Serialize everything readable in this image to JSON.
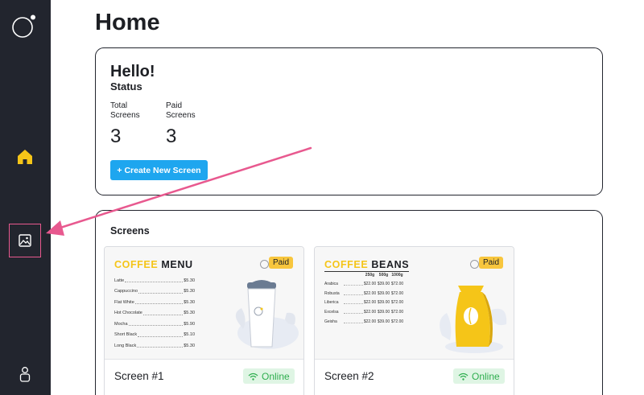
{
  "sidebar": {
    "items": [
      {
        "name": "home",
        "icon": "home-icon",
        "color": "#f5c518"
      },
      {
        "name": "screens",
        "icon": "image-icon",
        "highlight": "#e8598f"
      },
      {
        "name": "account",
        "icon": "user-icon"
      }
    ]
  },
  "page": {
    "title": "Home"
  },
  "status_card": {
    "greeting": "Hello!",
    "title": "Status",
    "stats": [
      {
        "label_line1": "Total",
        "label_line2": "Screens",
        "value": "3"
      },
      {
        "label_line1": "Paid",
        "label_line2": "Screens",
        "value": "3"
      }
    ],
    "create_button": "+ Create New Screen"
  },
  "screens_panel": {
    "title": "Screens",
    "cards": [
      {
        "name": "Screen #1",
        "status": "Online",
        "badge": "Paid",
        "preview": {
          "title_accent": "COFFEE",
          "title_rest": "MENU",
          "items": [
            {
              "name": "Latte",
              "price": "$5.30"
            },
            {
              "name": "Cappuccino",
              "price": "$5.30"
            },
            {
              "name": "Flat White",
              "price": "$5.30"
            },
            {
              "name": "Hot Chocolate",
              "price": "$5.30"
            },
            {
              "name": "Mocha",
              "price": "$5.90"
            },
            {
              "name": "Short Black",
              "price": "$5.10"
            },
            {
              "name": "Long Black",
              "price": "$5.30"
            }
          ]
        }
      },
      {
        "name": "Screen #2",
        "status": "Online",
        "badge": "Paid",
        "preview": {
          "title_accent": "COFFEE",
          "title_rest": "BEANS",
          "columns": [
            "250g",
            "500g",
            "1000g"
          ],
          "rows": [
            {
              "name": "Arabica",
              "prices": [
                "$22.00",
                "$39.00",
                "$72.00"
              ]
            },
            {
              "name": "Robusta",
              "prices": [
                "$22.00",
                "$39.00",
                "$72.00"
              ]
            },
            {
              "name": "Liberica",
              "prices": [
                "$22.00",
                "$39.00",
                "$72.00"
              ]
            },
            {
              "name": "Excelsa",
              "prices": [
                "$22.00",
                "$39.00",
                "$72.00"
              ]
            },
            {
              "name": "Geisha",
              "prices": [
                "$22.00",
                "$39.00",
                "$72.00"
              ]
            }
          ]
        }
      }
    ]
  },
  "colors": {
    "sidebar_bg": "#22252e",
    "accent_yellow": "#f5c518",
    "button_blue": "#1ea6ef",
    "online_green": "#2fae4f",
    "annotation_pink": "#e8598f"
  }
}
